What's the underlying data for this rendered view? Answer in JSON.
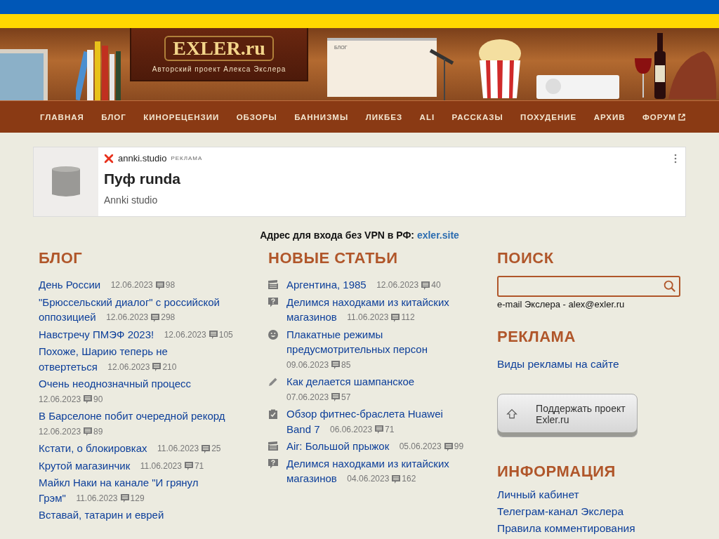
{
  "site": {
    "logo": "EXLER.ru",
    "tagline": "Авторский проект Алекса Экслера",
    "calendar_label": "БЛОГ"
  },
  "nav": [
    {
      "label": "ГЛАВНАЯ",
      "external": false
    },
    {
      "label": "БЛОГ",
      "external": false
    },
    {
      "label": "КИНОРЕЦЕНЗИИ",
      "external": false
    },
    {
      "label": "ОБЗОРЫ",
      "external": false
    },
    {
      "label": "БАННИЗМЫ",
      "external": false
    },
    {
      "label": "ЛИКБЕЗ",
      "external": false
    },
    {
      "label": "ALI",
      "external": false
    },
    {
      "label": "РАССКАЗЫ",
      "external": false
    },
    {
      "label": "ПОХУДЕНИЕ",
      "external": false
    },
    {
      "label": "АРХИВ",
      "external": false
    },
    {
      "label": "ФОРУМ",
      "external": true
    }
  ],
  "ad": {
    "domain": "annki.studio",
    "badge": "РЕКЛАМА",
    "title": "Пуф runda",
    "advertiser": "Annki studio"
  },
  "vpn_notice": {
    "text": "Адрес для входа без VPN в РФ:",
    "link": "exler.site"
  },
  "blog": {
    "heading": "БЛОГ",
    "posts": [
      {
        "title": "День России",
        "date": "12.06.2023",
        "comments": "98"
      },
      {
        "title": "\"Брюссельский диалог\" с российской оппозицией",
        "date": "12.06.2023",
        "comments": "298"
      },
      {
        "title": "Навстречу ПМЭФ 2023!",
        "date": "12.06.2023",
        "comments": "105"
      },
      {
        "title": "Похоже, Шарию теперь не отвертеться",
        "date": "12.06.2023",
        "comments": "210"
      },
      {
        "title": "Очень неоднозначный процесс",
        "date": "12.06.2023",
        "comments": "90"
      },
      {
        "title": "В Барселоне побит очередной рекорд",
        "date": "12.06.2023",
        "comments": "89"
      },
      {
        "title": "Кстати, о блокировках",
        "date": "11.06.2023",
        "comments": "25"
      },
      {
        "title": "Крутой магазинчик",
        "date": "11.06.2023",
        "comments": "71"
      },
      {
        "title": "Майкл Наки на канале \"И грянул Грэм\"",
        "date": "11.06.2023",
        "comments": "129"
      },
      {
        "title": "Вставай, татарин и еврей"
      }
    ]
  },
  "new_articles": {
    "heading": "НОВЫЕ СТАТЬИ",
    "articles": [
      {
        "kind": "film",
        "title": "Аргентина, 1985",
        "date": "12.06.2023",
        "comments": "40"
      },
      {
        "kind": "question",
        "title": "Делимся находками из китайских магазинов",
        "date": "11.06.2023",
        "comments": "112"
      },
      {
        "kind": "smile",
        "title": "Плакатные режимы предусмотрительных персон",
        "date": "09.06.2023",
        "comments": "85"
      },
      {
        "kind": "pencil",
        "title": "Как делается шампанское",
        "date": "07.06.2023",
        "comments": "57"
      },
      {
        "kind": "review",
        "title": "Обзор фитнес-браслета Huawei Band 7",
        "date": "06.06.2023",
        "comments": "71"
      },
      {
        "kind": "film",
        "title": "Air: Большой прыжок",
        "date": "05.06.2023",
        "comments": "99"
      },
      {
        "kind": "question",
        "title": "Делимся находками из китайских магазинов",
        "date": "04.06.2023",
        "comments": "162"
      }
    ]
  },
  "search": {
    "heading": "ПОИСК",
    "email_line": "e-mail Экслера - alex@exler.ru"
  },
  "advertising": {
    "heading": "РЕКЛАМА",
    "links": [
      "Виды рекламы на сайте"
    ]
  },
  "support_button": {
    "label": "Поддержать проект Exler.ru"
  },
  "info": {
    "heading": "ИНФОРМАЦИЯ",
    "links": [
      "Личный кабинет",
      "Телеграм-канал Экслера",
      "Правила комментирования"
    ]
  }
}
